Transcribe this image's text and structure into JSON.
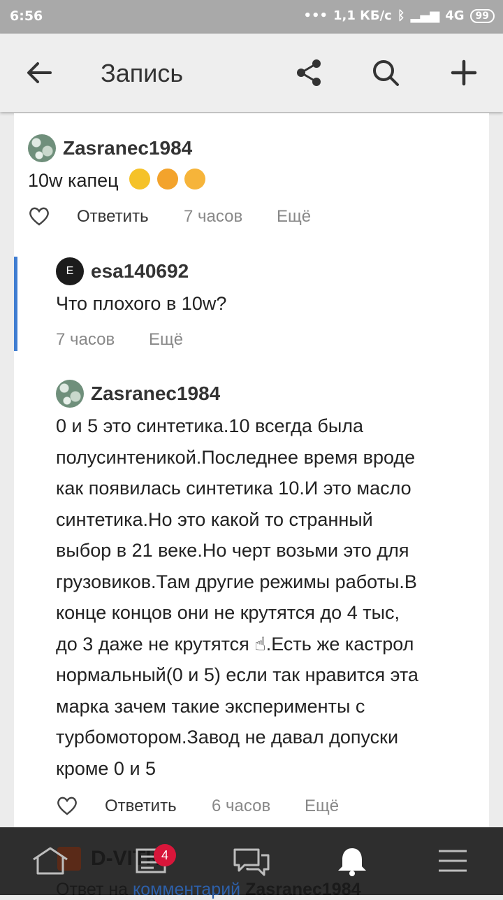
{
  "status": {
    "time": "6:56",
    "network_speed": "1,1 КБ/с",
    "network_type": "4G",
    "battery": "99"
  },
  "appbar": {
    "title": "Запись"
  },
  "comments": [
    {
      "author": "Zasranec1984",
      "text": "10w капец",
      "reply_label": "Ответить",
      "time": "7 часов",
      "more_label": "Ещё"
    },
    {
      "author": "esa140692",
      "avatar_letter": "E",
      "text": "Что плохого в 10w?",
      "time": "7 часов",
      "more_label": "Ещё"
    },
    {
      "author": "Zasranec1984",
      "lines": [
        "0 и 5 это синтетика.10 всегда была",
        "полусинтеникой.Последнее время вроде",
        "как появилась синтетика 10.И это масло",
        "синтетика.Но это какой то странный",
        "выбор в 21 веке.Но черт возьми это для",
        "грузовиков.Там другие режимы работы.В",
        "конце концов они не крутятся до 4 тыс,",
        "до 3 даже не крутятся ☝.Есть же кастрол",
        "нормальный(0 и 5) если так нравится эта",
        "марка зачем такие эксперименты с",
        "турбомотором.Завод не давал допуски",
        "кроме 0 и 5"
      ],
      "reply_label": "Ответить",
      "time": "6 часов",
      "more_label": "Ещё"
    }
  ],
  "behind_nav": {
    "author": "D-VITK",
    "reply_prefix": "Ответ на",
    "reply_link": "комментарий",
    "reply_target": "Zasranec1984"
  },
  "bottom_nav": {
    "badge_count": "4"
  },
  "colors": {
    "accent": "#3f7dd1",
    "badge": "#d8163a",
    "nav_bg": "#2e2e2e"
  }
}
